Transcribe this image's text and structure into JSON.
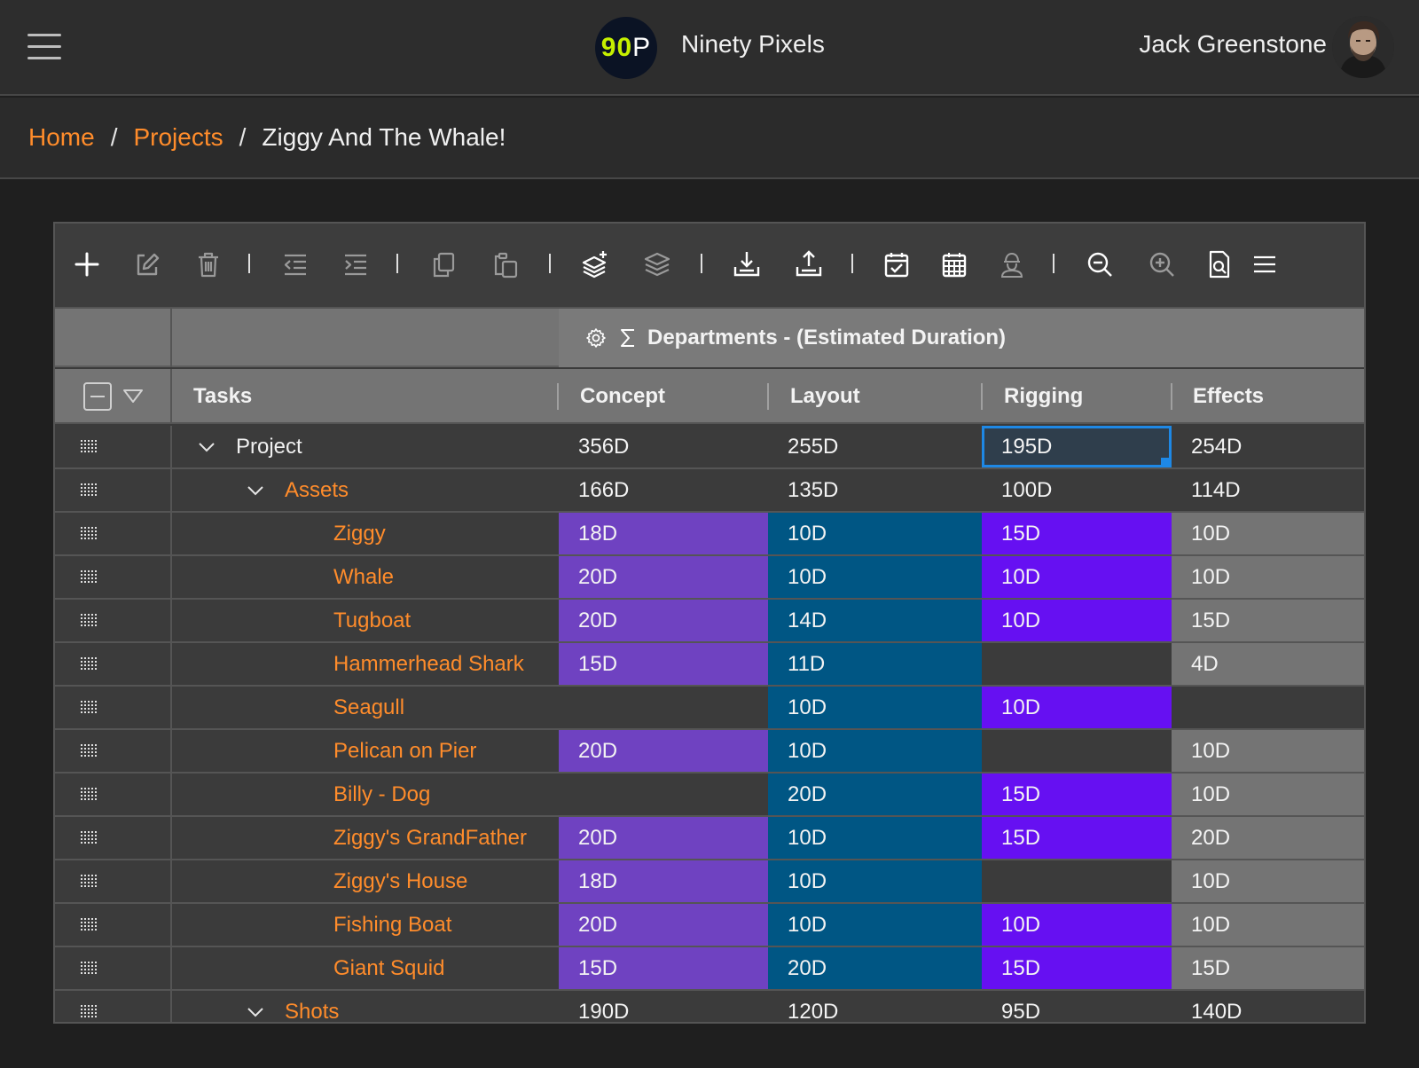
{
  "header": {
    "brand_logo_text_a": "90",
    "brand_logo_text_b": "P",
    "brand_name": "Ninety Pixels",
    "user_name": "Jack Greenstone"
  },
  "breadcrumb": {
    "home": "Home",
    "projects": "Projects",
    "current": "Ziggy And The Whale!",
    "separator": "/"
  },
  "toolbar": {
    "icons": [
      "add-icon",
      "edit-icon",
      "delete-icon",
      "outdent-icon",
      "indent-icon",
      "copy-icon",
      "paste-icon",
      "add-layer-icon",
      "layers-icon",
      "download-icon",
      "upload-icon",
      "calendar-check-icon",
      "calendar-grid-icon",
      "worker-icon",
      "zoom-out-icon",
      "zoom-in-icon",
      "search-document-icon",
      "menu-icon"
    ]
  },
  "grid": {
    "group_header": "Departments - (Estimated Duration)",
    "columns": {
      "tasks": "Tasks",
      "concept": "Concept",
      "layout": "Layout",
      "rigging": "Rigging",
      "effects": "Effects"
    },
    "colors": {
      "concept": "#6f42c1",
      "layout": "#005684",
      "rigging": "#6610f2",
      "effects": "#747474",
      "empty": "#3b3b3b",
      "accent": "#ff8c2b"
    },
    "rows": [
      {
        "task": "Project",
        "level": 0,
        "kind": "sum",
        "concept": "356D",
        "layout": "255D",
        "rigging": "195D",
        "effects": "254D"
      },
      {
        "task": "Assets",
        "level": 1,
        "kind": "group",
        "concept": "166D",
        "layout": "135D",
        "rigging": "100D",
        "effects": "114D"
      },
      {
        "task": "Ziggy",
        "level": 2,
        "kind": "leaf",
        "concept": "18D",
        "layout": "10D",
        "rigging": "15D",
        "effects": "10D"
      },
      {
        "task": "Whale",
        "level": 2,
        "kind": "leaf",
        "concept": "20D",
        "layout": "10D",
        "rigging": "10D",
        "effects": "10D"
      },
      {
        "task": "Tugboat",
        "level": 2,
        "kind": "leaf",
        "concept": "20D",
        "layout": "14D",
        "rigging": "10D",
        "effects": "15D"
      },
      {
        "task": "Hammerhead Shark",
        "level": 2,
        "kind": "leaf",
        "concept": "15D",
        "layout": "11D",
        "rigging": "",
        "effects": "4D"
      },
      {
        "task": "Seagull",
        "level": 2,
        "kind": "leaf",
        "concept": "",
        "layout": "10D",
        "rigging": "10D",
        "effects": ""
      },
      {
        "task": "Pelican on Pier",
        "level": 2,
        "kind": "leaf",
        "concept": "20D",
        "layout": "10D",
        "rigging": "",
        "effects": "10D"
      },
      {
        "task": "Billy - Dog",
        "level": 2,
        "kind": "leaf",
        "concept": "",
        "layout": "20D",
        "rigging": "15D",
        "effects": "10D"
      },
      {
        "task": "Ziggy's GrandFather",
        "level": 2,
        "kind": "leaf",
        "concept": "20D",
        "layout": "10D",
        "rigging": "15D",
        "effects": "20D"
      },
      {
        "task": "Ziggy's House",
        "level": 2,
        "kind": "leaf",
        "concept": "18D",
        "layout": "10D",
        "rigging": "",
        "effects": "10D"
      },
      {
        "task": "Fishing Boat",
        "level": 2,
        "kind": "leaf",
        "concept": "20D",
        "layout": "10D",
        "rigging": "10D",
        "effects": "10D"
      },
      {
        "task": "Giant Squid",
        "level": 2,
        "kind": "leaf",
        "concept": "15D",
        "layout": "20D",
        "rigging": "15D",
        "effects": "15D"
      },
      {
        "task": "Shots",
        "level": 1,
        "kind": "group",
        "concept": "190D",
        "layout": "120D",
        "rigging": "95D",
        "effects": "140D"
      }
    ]
  }
}
